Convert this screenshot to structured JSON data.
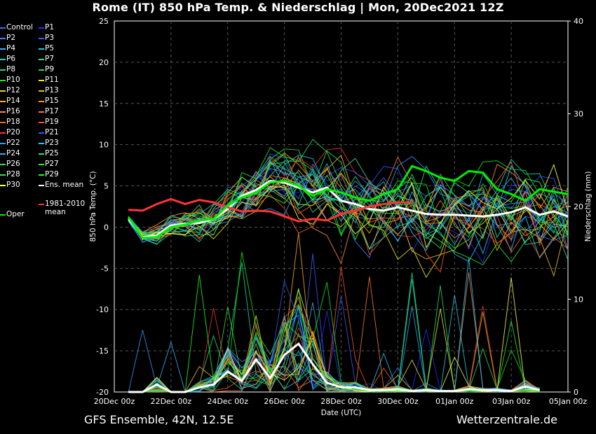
{
  "title": "Rome  (IT)  850 hPa Temp. & Niederschlag | Mon, 20Dec2021 12Z",
  "footer": {
    "left": "GFS Ensemble, 42N, 12.5E",
    "right": "Wetterzentrale.de"
  },
  "colors": {
    "ens_mean": "#ffffff",
    "climatology": "#ff3333",
    "oper": "#00ee00",
    "control": "#3366ff"
  },
  "legend": [
    {
      "label": "Control",
      "color": "#3a6bff"
    },
    {
      "label": "P1",
      "color": "#2a2aff"
    },
    {
      "label": "P2",
      "color": "#4a7dff"
    },
    {
      "label": "P3",
      "color": "#3b5bff"
    },
    {
      "label": "P4",
      "color": "#3fb0ff"
    },
    {
      "label": "P5",
      "color": "#22ccee"
    },
    {
      "label": "P6",
      "color": "#22d4c0"
    },
    {
      "label": "P7",
      "color": "#22e0a0"
    },
    {
      "label": "P8",
      "color": "#22e070"
    },
    {
      "label": "P9",
      "color": "#22e050"
    },
    {
      "label": "P10",
      "color": "#11ee11"
    },
    {
      "label": "P11",
      "color": "#eeee22"
    },
    {
      "label": "P12",
      "color": "#eecc33"
    },
    {
      "label": "P13",
      "color": "#eebb22"
    },
    {
      "label": "P14",
      "color": "#ffaa22"
    },
    {
      "label": "P15",
      "color": "#ff9900"
    },
    {
      "label": "P16",
      "color": "#ff8844"
    },
    {
      "label": "P17",
      "color": "#ff7733"
    },
    {
      "label": "P18",
      "color": "#ff6622"
    },
    {
      "label": "P19",
      "color": "#ff5522"
    },
    {
      "label": "P20",
      "color": "#ee3333"
    },
    {
      "label": "P21",
      "color": "#3355ff"
    },
    {
      "label": "P22",
      "color": "#3399ff"
    },
    {
      "label": "P23",
      "color": "#22ccff"
    },
    {
      "label": "P24",
      "color": "#33aaee"
    },
    {
      "label": "P25",
      "color": "#22dd99"
    },
    {
      "label": "P26",
      "color": "#33dd66"
    },
    {
      "label": "P27",
      "color": "#22ee44"
    },
    {
      "label": "P28",
      "color": "#44dd44"
    },
    {
      "label": "P29",
      "color": "#22ff22"
    },
    {
      "label": "P30",
      "color": "#ffff55"
    },
    {
      "label": "Ens. mean",
      "color": "#ffffff"
    },
    {
      "label": "Oper",
      "color": "#00ee00"
    },
    {
      "label": "1981-2010\nmean",
      "color": "#ff3333"
    }
  ],
  "chart_data": {
    "type": "line",
    "xlabel": "Date (UTC)",
    "ylabel": "850 hPa Temp. (°C)",
    "y2label": "Niederschlag (mm)",
    "ylim": [
      -20,
      25
    ],
    "y2lim": [
      0,
      40
    ],
    "yticks": [
      25,
      20,
      15,
      10,
      5,
      0,
      -5,
      -10,
      -15,
      -20
    ],
    "y2ticks": [
      40,
      30,
      20,
      10,
      0
    ],
    "xticks": [
      "20Dec 00z",
      "22Dec 00z",
      "24Dec 00z",
      "26Dec 00z",
      "28Dec 00z",
      "30Dec 00z",
      "01Jan 00z",
      "03Jan 00z",
      "05Jan 00z"
    ],
    "x_days_from_start": [
      0.5,
      1,
      1.5,
      2,
      2.5,
      3,
      3.5,
      4,
      4.5,
      5,
      5.5,
      6,
      6.5,
      7,
      7.5,
      8,
      8.5,
      9,
      9.5,
      10,
      10.5,
      11,
      11.5,
      12,
      12.5,
      13,
      13.5,
      14,
      14.5,
      15,
      15.5,
      16
    ],
    "series": [
      {
        "name": "Ens. mean",
        "values": [
          1.0,
          -1.2,
          -1.0,
          0.2,
          0.4,
          0.5,
          1.0,
          2.2,
          3.8,
          4.5,
          5.6,
          5.4,
          4.8,
          4.2,
          4.8,
          3.2,
          2.8,
          2.2,
          2.0,
          2.4,
          2.0,
          1.6,
          1.5,
          1.5,
          1.4,
          1.3,
          1.5,
          1.8,
          2.4,
          1.5,
          1.9,
          1.3
        ]
      },
      {
        "name": "1981-2010 mean",
        "values": [
          2.1,
          2.0,
          2.8,
          3.4,
          2.8,
          3.3,
          3.0,
          2.4,
          1.9,
          2.0,
          1.9,
          1.3,
          0.7,
          1.0,
          0.8,
          1.6,
          2.0,
          2.5,
          2.8,
          3.0,
          3.0
        ]
      },
      {
        "name": "Oper",
        "values": [
          1.2,
          -1.3,
          -1.2,
          0.0,
          0.3,
          0.8,
          1.0,
          2.6,
          3.6,
          4.2,
          5.4,
          5.6,
          5.0,
          3.8,
          4.6,
          4.2,
          3.6,
          3.2,
          4.0,
          4.6,
          7.4,
          6.8,
          6.0,
          5.6,
          6.8,
          6.6,
          4.6,
          4.0,
          3.2,
          4.6,
          4.3,
          4.0
        ]
      }
    ],
    "precipitation_mean_mm": [
      0,
      0,
      0.8,
      0,
      0,
      0.5,
      0.8,
      2.2,
      1.2,
      3.5,
      1.5,
      4.0,
      5.2,
      3.0,
      1.0,
      0.5,
      0.5,
      0.2,
      0.2,
      0.3,
      0.1,
      0.2,
      0.1,
      0.1,
      0.3,
      0.2,
      0.2,
      0.1,
      0.6,
      0.2
    ]
  }
}
